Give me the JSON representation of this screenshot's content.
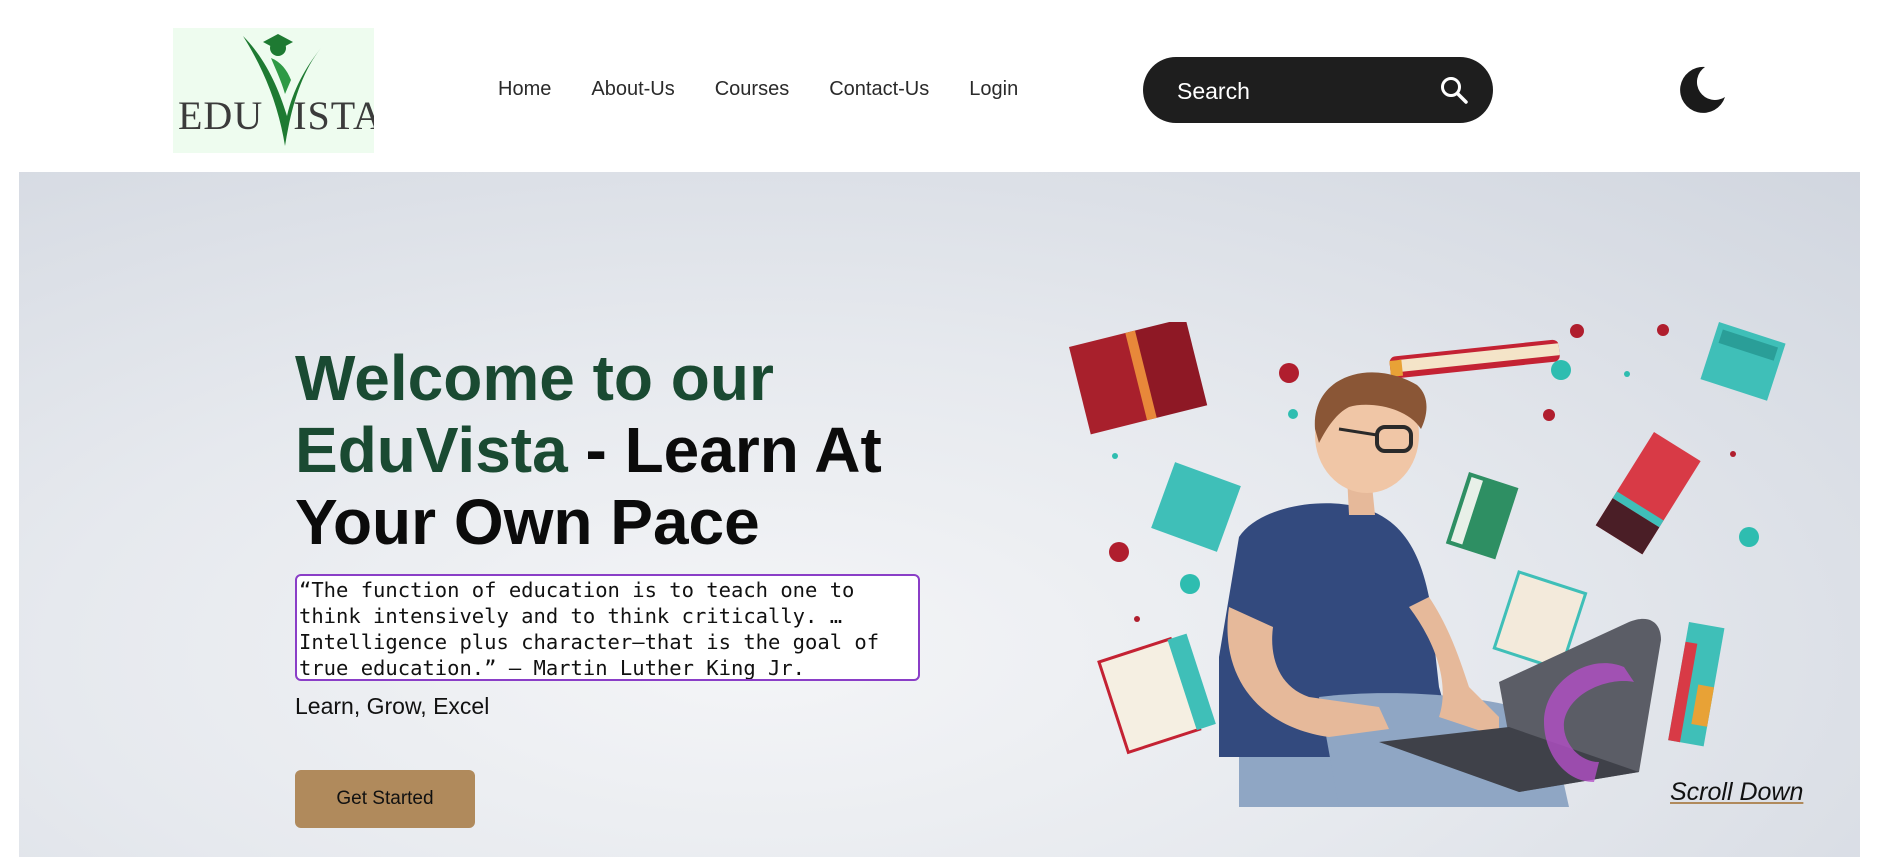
{
  "brand": {
    "logo_text_left": "EDU",
    "logo_text_right": "ISTA",
    "logo_color": "#1e7a32"
  },
  "nav": {
    "items": [
      {
        "label": "Home"
      },
      {
        "label": "About-Us"
      },
      {
        "label": "Courses"
      },
      {
        "label": "Contact-Us"
      },
      {
        "label": "Login"
      }
    ]
  },
  "search": {
    "placeholder": "Search",
    "icon": "search-icon"
  },
  "theme_toggle": {
    "icon": "moon-icon"
  },
  "hero": {
    "headline_part1": "Welcome to our",
    "headline_brand": "EduVista",
    "headline_part2": " - Learn At Your Own Pace",
    "quote": "“The function of education is to teach one to think intensively and to think critically. … Intelligence plus character—that is the goal of true education.” — Martin Luther King Jr.",
    "tagline": "Learn, Grow, Excel",
    "cta_label": "Get Started",
    "scroll_label": "Scroll Down",
    "illustration": "student-with-laptop-and-books-illustration"
  },
  "colors": {
    "headline_green": "#1a4a32",
    "cta_bg": "#b08a5c",
    "quote_border": "#8a3ec7",
    "search_bg": "#1e1e1e"
  }
}
